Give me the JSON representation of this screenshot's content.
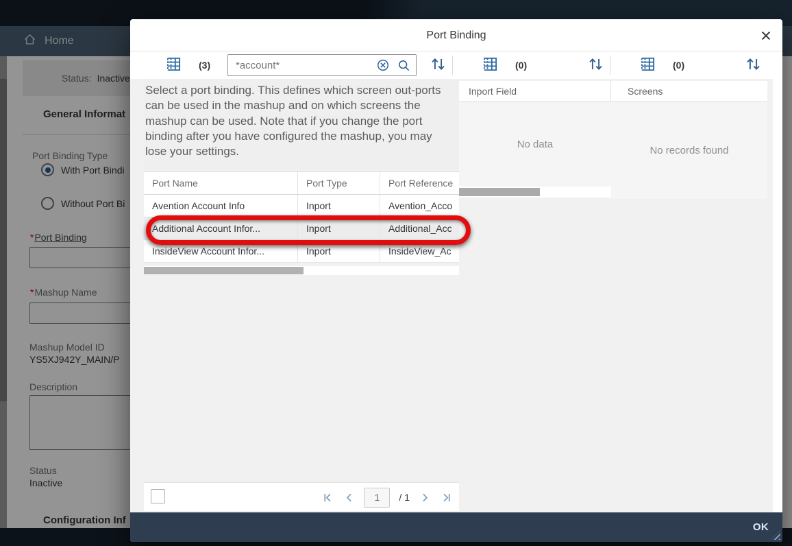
{
  "page": {
    "nav": {
      "home_label": "Home"
    },
    "status_banner": {
      "label": "Status:",
      "value": "Inactive"
    },
    "sections": {
      "general_info": "General Informat",
      "config_info": "Configuration Inf"
    },
    "form": {
      "required_marker": "*",
      "port_binding_type_label": "Port Binding Type",
      "radio_with_label": "With Port Bindi",
      "radio_without_label": "Without Port Bi",
      "port_binding_label": "Port Binding",
      "mashup_name_label": "Mashup Name",
      "mashup_model_id_label": "Mashup Model ID",
      "mashup_model_id_value": "YS5XJ942Y_MAIN/P",
      "description_label": "Description",
      "status_label": "Status",
      "status_value": "Inactive"
    }
  },
  "dialog": {
    "title": "Port Binding",
    "info_text": "Select a port binding. This defines which screen out-ports can be used in the mashup and on which screens the mashup can be used. Note that if you change the port binding after you have configured the mashup, you may lose your settings.",
    "toolbars": [
      {
        "count": "(3)",
        "search_value": "*account*"
      },
      {
        "count": "(0)"
      },
      {
        "count": "(0)"
      }
    ],
    "port_table": {
      "columns": [
        "Port Name",
        "Port Type",
        "Port Reference"
      ],
      "rows": [
        {
          "name": "Avention Account Info",
          "type": "Inport",
          "reference": "Avention_Acco"
        },
        {
          "name": "Additional Account Infor...",
          "type": "Inport",
          "reference": "Additional_Acc"
        },
        {
          "name": "InsideView Account Infor...",
          "type": "Inport",
          "reference": "InsideView_Ac"
        }
      ],
      "highlighted_row_index": 1
    },
    "inport_field_panel": {
      "header": "Inport Field",
      "empty_text": "No data"
    },
    "screens_panel": {
      "header": "Screens",
      "empty_text": "No records found"
    },
    "pagination": {
      "current_page": "1",
      "total_label": "/ 1"
    },
    "footer": {
      "ok_label": "OK"
    }
  },
  "colors": {
    "accent_blue": "#2d6aa3",
    "annotation_red": "#e20d0d",
    "footer_bar": "#2f3d50"
  }
}
